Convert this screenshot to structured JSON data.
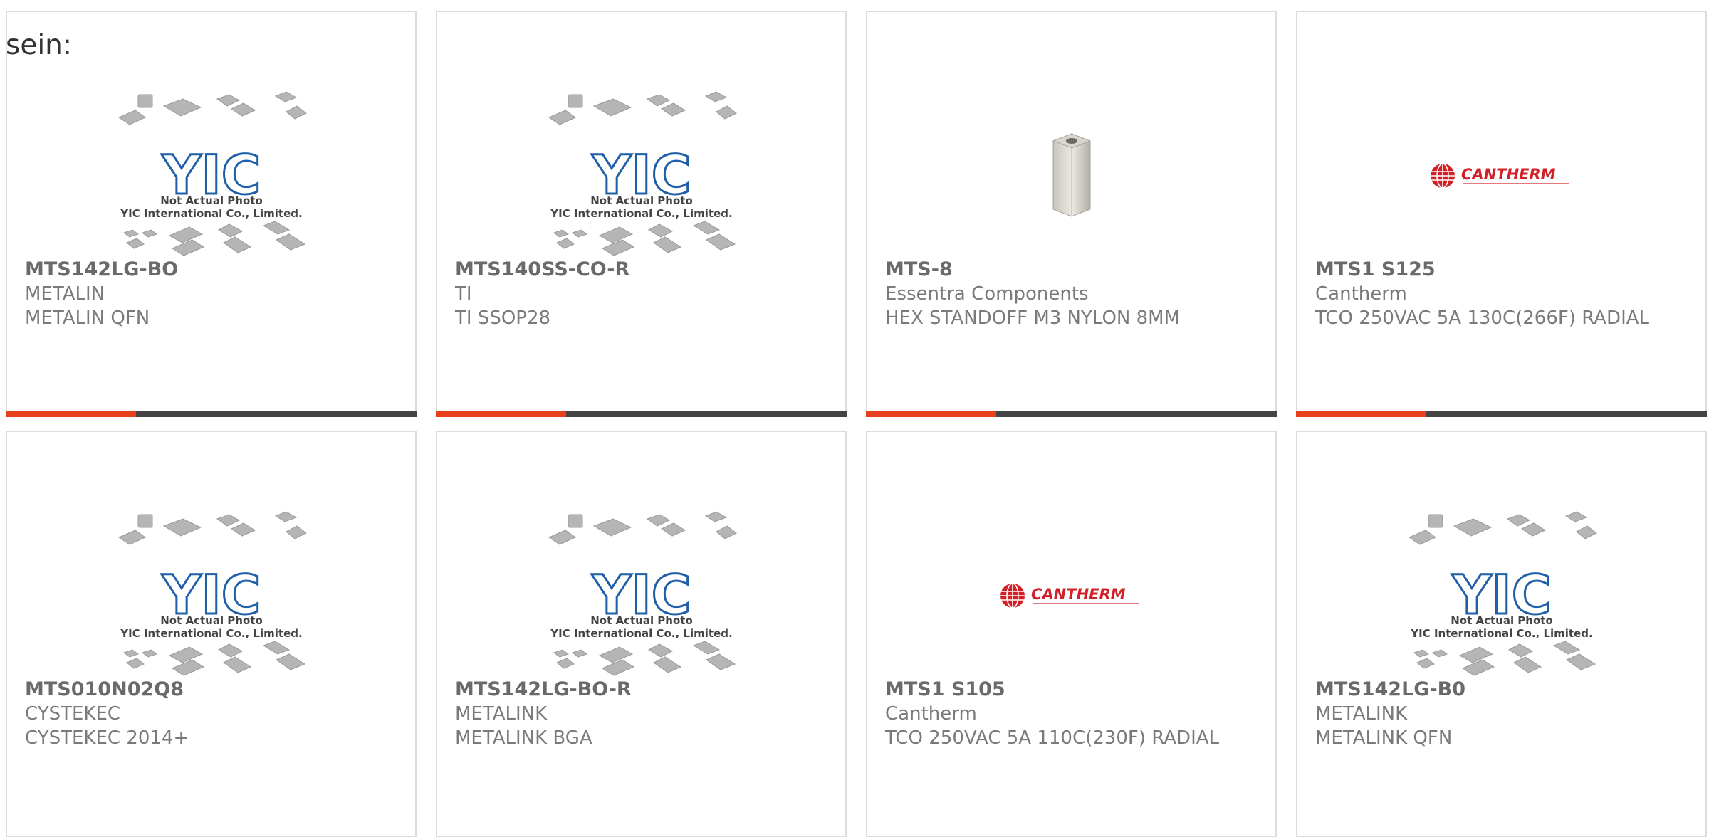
{
  "lead_text": "sein:",
  "placeholder_note": {
    "line1": "Not Actual Photo",
    "line2": "YIC International Co., Limited."
  },
  "brand_logo_text": "CANTHERM",
  "cards": [
    {
      "part": "MTS142LG-BO",
      "manufacturer": "METALIN",
      "description": "METALIN QFN",
      "image": "yic-placeholder"
    },
    {
      "part": "MTS140SS-CO-R",
      "manufacturer": "TI",
      "description": "TI SSOP28",
      "image": "yic-placeholder"
    },
    {
      "part": "MTS-8",
      "manufacturer": "Essentra Components",
      "description": "HEX STANDOFF M3 NYLON 8MM",
      "image": "hex-standoff"
    },
    {
      "part": "MTS1 S125",
      "manufacturer": "Cantherm",
      "description": "TCO 250VAC 5A 130C(266F) RADIAL",
      "image": "cantherm-logo"
    },
    {
      "part": "MTS010N02Q8",
      "manufacturer": "CYSTEKEC",
      "description": "CYSTEKEC 2014+",
      "image": "yic-placeholder"
    },
    {
      "part": "MTS142LG-BO-R",
      "manufacturer": "METALINK",
      "description": "METALINK BGA",
      "image": "yic-placeholder"
    },
    {
      "part": "MTS1 S105",
      "manufacturer": "Cantherm",
      "description": "TCO 250VAC 5A 110C(230F) RADIAL",
      "image": "cantherm-logo"
    },
    {
      "part": "MTS142LG-B0",
      "manufacturer": "METALINK",
      "description": "METALINK QFN",
      "image": "yic-placeholder"
    }
  ],
  "colors": {
    "accent": "#e8401c",
    "bar": "#444444",
    "cantherm_red": "#d32027",
    "yic_blue": "#1f5fa8"
  }
}
